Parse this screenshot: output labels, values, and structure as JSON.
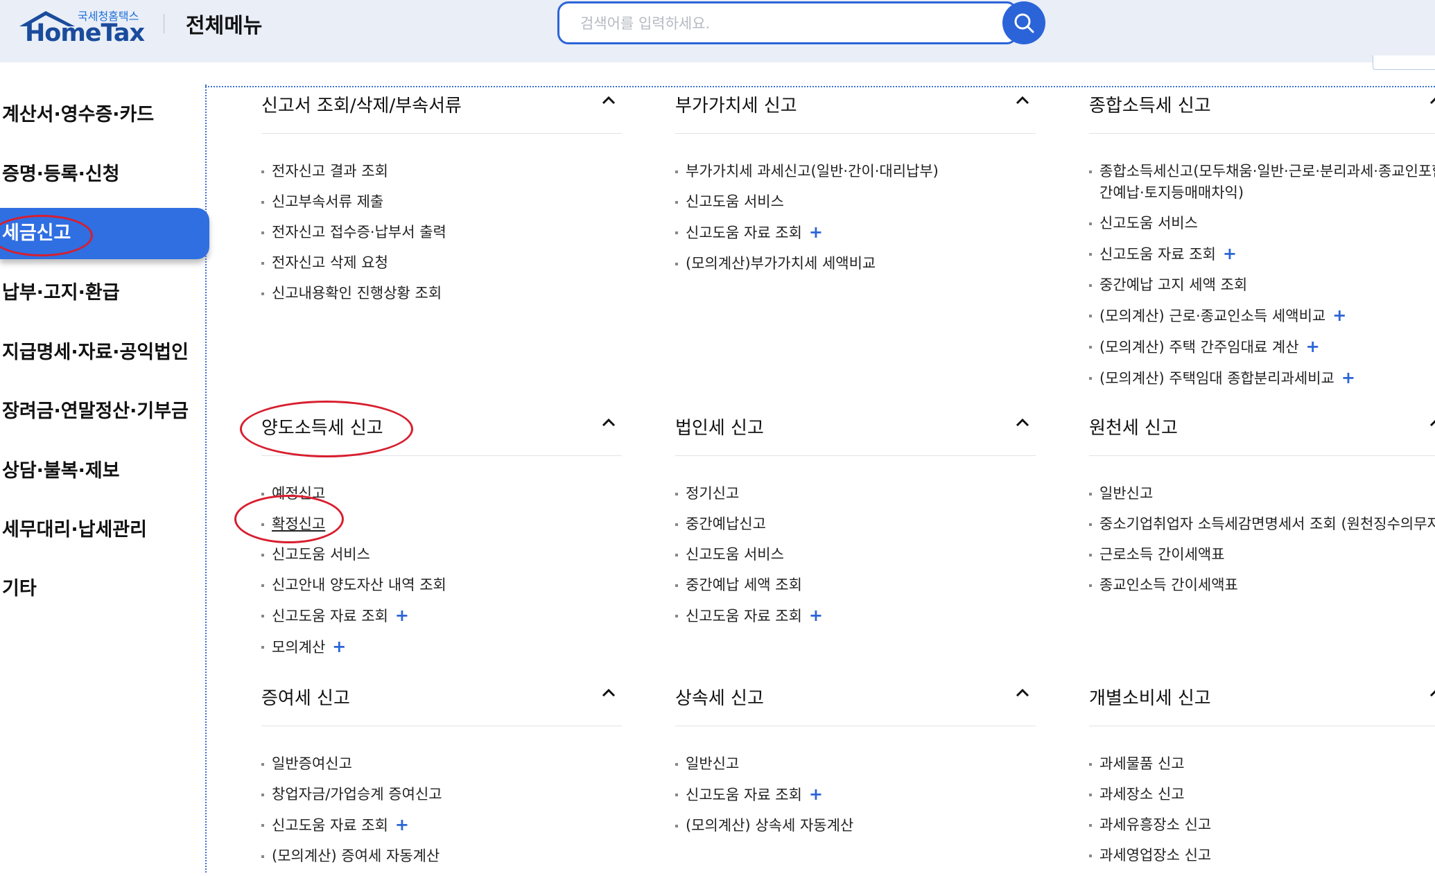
{
  "header": {
    "logo_small": "국세청홈택스",
    "logo_big": "HomeTax",
    "title": "전체메뉴",
    "search_placeholder": "검색어를 입력하세요."
  },
  "sidebar": {
    "items": [
      {
        "label": "계산서·영수증·카드"
      },
      {
        "label": "증명·등록·신청"
      },
      {
        "label": "세금신고"
      },
      {
        "label": "납부·고지·환급"
      },
      {
        "label": "지급명세·자료·공익법인"
      },
      {
        "label": "장려금·연말정산·기부금"
      },
      {
        "label": "상담·불복·제보"
      },
      {
        "label": "세무대리·납세관리"
      },
      {
        "label": "기타"
      }
    ]
  },
  "sections": [
    {
      "title": "신고서 조회/삭제/부속서류",
      "items": [
        "전자신고 결과 조회",
        "신고부속서류 제출",
        "전자신고 접수증·납부서 출력",
        "전자신고 삭제 요청",
        "신고내용확인 진행상황 조회"
      ]
    },
    {
      "title": "부가가치세 신고",
      "items": [
        "부가가치세 과세신고(일반·간이·대리납부)",
        "신고도움 서비스",
        "신고도움 자료 조회",
        "(모의계산)부가가치세 세액비교"
      ]
    },
    {
      "title": "종합소득세 신고",
      "items": [
        "종합소득세신고(모두채움·일반·근로·분리과세·종교인포함) 및 중간예납·토지등매매차익)",
        "신고도움 서비스",
        "신고도움 자료 조회",
        "중간예납 고지 세액 조회",
        "(모의계산) 근로·종교인소득 세액비교",
        "(모의계산) 주택 간주임대료 계산",
        "(모의계산) 주택임대 종합분리과세비교"
      ]
    },
    {
      "title": "양도소득세 신고",
      "items": [
        "예정신고",
        "확정신고",
        "신고도움 서비스",
        "신고안내 양도자산 내역 조회",
        "신고도움 자료 조회",
        "모의계산"
      ]
    },
    {
      "title": "법인세 신고",
      "items": [
        "정기신고",
        "중간예납신고",
        "신고도움 서비스",
        "중간예납 세액 조회",
        "신고도움 자료 조회"
      ]
    },
    {
      "title": "원천세 신고",
      "items": [
        "일반신고",
        "중소기업취업자 소득세감면명세서 조회 (원천징수의무자용)",
        "근로소득 간이세액표",
        "종교인소득 간이세액표"
      ]
    },
    {
      "title": "증여세 신고",
      "items": [
        "일반증여신고",
        "창업자금/가업승계 증여신고",
        "신고도움 자료 조회",
        "(모의계산) 증여세 자동계산"
      ]
    },
    {
      "title": "상속세 신고",
      "items": [
        "일반신고",
        "신고도움 자료 조회",
        "(모의계산) 상속세 자동계산"
      ]
    },
    {
      "title": "개별소비세 신고",
      "items": [
        "과세물품 신고",
        "과세장소 신고",
        "과세유흥장소 신고",
        "과세영업장소 신고"
      ]
    }
  ],
  "plus_symbol": "+",
  "colors": {
    "accent": "#2b64d8",
    "active_menu": "#2f6fe2",
    "annotation": "#d81e2e"
  },
  "icons": {
    "search": "search-icon",
    "collapse": "chevron-up-icon"
  }
}
